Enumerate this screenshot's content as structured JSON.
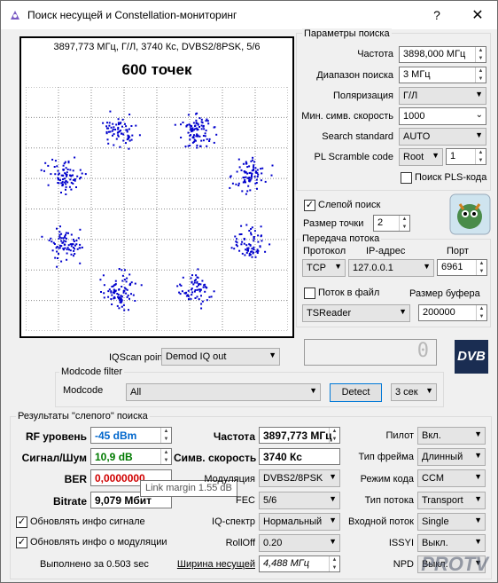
{
  "window": {
    "title": "Поиск несущей и Constellation-мониторинг",
    "help": "?",
    "close": "✕"
  },
  "plot": {
    "header": "3897,773 МГц, Г/Л, 3740 Кс, DVBS2/8PSK, 5/6",
    "points_label": "600 точек",
    "point_color": "#0000cc"
  },
  "search": {
    "group_title": "Параметры поиска",
    "freq_label": "Частота",
    "freq_value": "3898,000 МГц",
    "range_label": "Диапазон поиска",
    "range_value": "3 МГц",
    "pol_label": "Поляризация",
    "pol_value": "Г/Л",
    "minsr_label": "Мин. симв. скорость",
    "minsr_value": "1000",
    "std_label": "Search standard",
    "std_value": "AUTO",
    "pls_label": "PL Scramble code",
    "pls_mode": "Root",
    "pls_value": "1",
    "pls_search_label": "Поиск PLS-кода"
  },
  "blind": {
    "label": "Слепой поиск",
    "checked": "✓",
    "point_size_label": "Размер точки",
    "point_size": "2"
  },
  "stream": {
    "group_title": "Передача потока",
    "proto_label": "Протокол",
    "ip_label": "IP-адрес",
    "port_label": "Порт",
    "proto": "TCP",
    "ip": "127.0.0.1",
    "port": "6961",
    "tofile_label": "Поток в файл",
    "buffer_label": "Размер буфера",
    "reader": "TSReader",
    "buffer": "200000"
  },
  "display_digit": "0",
  "dvb_logo": "DVB",
  "iqscan": {
    "label": "IQScan point",
    "value": "Demod IQ out"
  },
  "modcode": {
    "group_title": "Modcode filter",
    "label": "Modcode",
    "value": "All",
    "detect": "Detect",
    "interval": "3 сек"
  },
  "results": {
    "group_title": "Результаты \"слепого\" поиска",
    "rf_label": "RF уровень",
    "rf_value": "-45 dBm",
    "snr_label": "Сигнал/Шум",
    "snr_value": "10,9 dB",
    "ber_label": "BER",
    "ber_value": "0,0000000",
    "bitrate_label": "Bitrate",
    "bitrate_value": "9,079 Мбит",
    "tooltip": "Link margin 1.55 dB",
    "freq_label": "Частота",
    "freq_value": "3897,773 МГц",
    "sr_label": "Симв. скорость",
    "sr_value": "3740 Кс",
    "mod_label": "Модуляция",
    "mod_value": "DVBS2/8PSK",
    "fec_label": "FEC",
    "fec_value": "5/6",
    "iq_label": "IQ-спектр",
    "iq_value": "Нормальный",
    "rolloff_label": "RollOff",
    "rolloff_value": "0.20",
    "bw_label": "Ширина несущей",
    "bw_value": "4,488 МГц",
    "pilot_label": "Пилот",
    "pilot_value": "Вкл.",
    "frame_label": "Тип фрейма",
    "frame_value": "Длинный",
    "codemode_label": "Режим кода",
    "codemode_value": "CCM",
    "streamtype_label": "Тип потока",
    "streamtype_value": "Transport",
    "input_label": "Входной поток",
    "input_value": "Single",
    "issyi_label": "ISSYI",
    "issyi_value": "Выкл.",
    "npd_label": "NPD",
    "npd_value": "Выкл.",
    "upd_signal_label": "Обновлять инфо сигнале",
    "upd_mod_label": "Обновлять инфо о модуляции",
    "done_label": "Выполнено за 0.503 sec"
  },
  "watermark": "PROTV"
}
